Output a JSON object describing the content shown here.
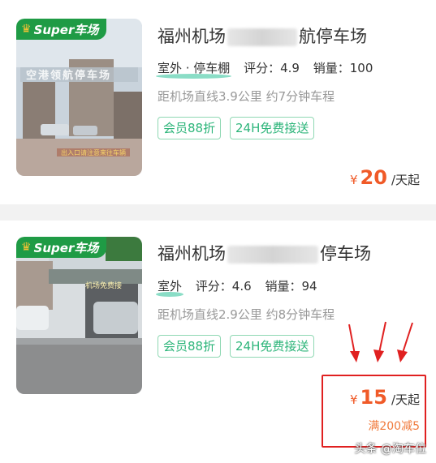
{
  "listings": [
    {
      "badge": "Super车场",
      "title_prefix": "福州机场",
      "title_suffix": "航停车场",
      "location_type": "室外 · 停车棚",
      "rating_label": "评分：4.9",
      "sales_label": "销量：100",
      "distance": "距机场直线3.9公里 约7分钟车程",
      "tags": [
        "会员88折",
        "24H免费接送"
      ],
      "price_currency": "¥",
      "price_value": "20",
      "price_unit": "/天起",
      "image_sign_text": "空港领航停车场",
      "image_footer_text": "出入口请注意来往车辆"
    },
    {
      "badge": "Super车场",
      "title_prefix": "福州机场",
      "title_suffix": "停车场",
      "location_type": "室外",
      "rating_label": "评分：4.6",
      "sales_label": "销量：94",
      "distance": "距机场直线2.9公里 约8分钟车程",
      "tags": [
        "会员88折",
        "24H免费接送"
      ],
      "price_currency": "¥",
      "price_value": "15",
      "price_unit": "/天起",
      "discount": "满200减5",
      "image_sign_text": "机场免费接"
    }
  ],
  "watermark": "头条 @淘车位",
  "colors": {
    "accent_green": "#2db57a",
    "price_orange": "#f05a28",
    "highlight_red": "#e02020",
    "badge_green": "#1f9b45"
  }
}
